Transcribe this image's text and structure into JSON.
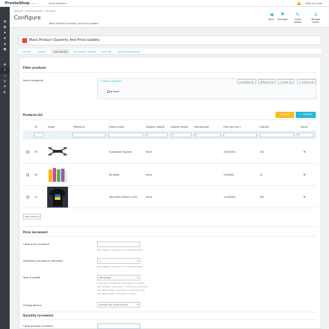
{
  "app": {
    "logo": "PrestaShop",
    "version": "1.6.1",
    "quick_access": "Quick Access ▾",
    "view_shop": "View my shop"
  },
  "sidebar": {
    "icons": [
      "cart-icon",
      "user-icon",
      "chat-icon",
      "chart-icon",
      "puzzle-icon",
      "desktop-icon",
      "truck-icon",
      "globe-icon",
      "gear-icon",
      "settings-icon",
      "stats-icon"
    ]
  },
  "header": {
    "breadcrumb": "Modules  ›  quantityupdate  ›  Configure",
    "title": "Configure",
    "subtitle": "Mass Product Quantity And Price Update",
    "buttons": [
      {
        "label": "Back",
        "icon": "back-icon"
      },
      {
        "label": "Translate",
        "icon": "flag-icon"
      },
      {
        "label": "Check update",
        "icon": "refresh-icon"
      },
      {
        "label": "Manage hooks",
        "icon": "anchor-icon"
      }
    ]
  },
  "module": {
    "title": "Mass Product Quantity And Price Update"
  },
  "tabs": [
    "EXPORT",
    "UPDATE",
    "LIVE UPDATE",
    "AUTOMATIC UPDATE",
    "SUPPORT",
    "RELATED MODULES"
  ],
  "filter": {
    "heading": "Filter products",
    "categories_label": "Select categories",
    "tree_link": "Select categories",
    "collapse": "Collapse All",
    "expand": "Expand All",
    "check_all": "Check All",
    "uncheck_all": "Uncheck All",
    "home": "Home"
  },
  "products": {
    "heading": "Products list",
    "reset": "RESET",
    "search": "SEARCH",
    "columns": [
      "ID",
      "Image",
      "Reference",
      "Product name",
      "Category default",
      "Supplier default",
      "Manufacturer",
      "Price (tax excl.)",
      "Quantity",
      "Status"
    ],
    "rows": [
      {
        "id": "39",
        "name": "Quadcopter Sparrow",
        "category": "Home",
        "price": "20.000000",
        "qty": "100"
      },
      {
        "id": "40",
        "name": "My Bottle",
        "category": "Home",
        "price": "3.000000",
        "qty": "10"
      },
      {
        "id": "41",
        "name": "Tshirt With Ukraine t-shirt",
        "category": "Home",
        "price": "15.000000",
        "qty": "200"
      }
    ],
    "bulk": "Bulk actions"
  },
  "price_increment": {
    "heading": "Price increment",
    "new_price_label": "* New price increment",
    "new_price_help": "Percentage or amount to increase/decrease",
    "operations_label": "Operations (increase or decrease)",
    "operations_value": "+",
    "operations_help": "Percentage or amount to increase/decrease",
    "type_label": "Type of update",
    "type_value": "Percentage",
    "type_help1": "If you use \"Coefficient\" (new price) = present",
    "type_help2": "use \"Amount\" (new price = old price + amount)",
    "type_help3": "use \"Percentage\" (new price = old price ± %)",
    "type_help4": "use \"New value\" (new price = value)",
    "change_label": "Change options",
    "change_value": "Change only product prices"
  },
  "quantity_increment": {
    "heading": "Quantity increment",
    "new_qty_label": "* New quantity increment"
  }
}
